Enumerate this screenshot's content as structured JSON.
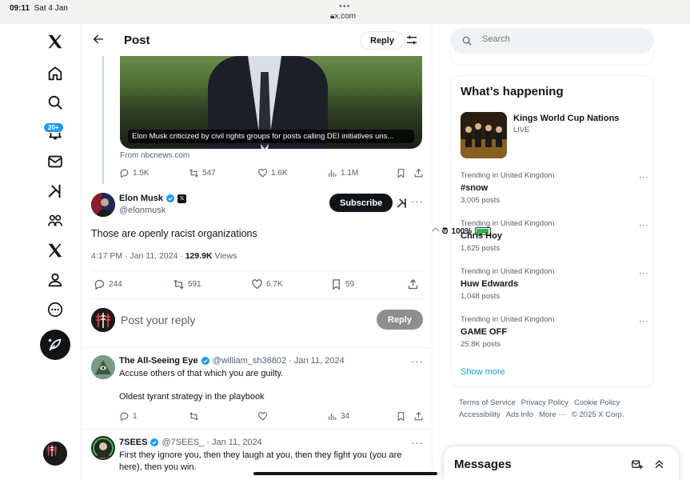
{
  "status_bar": {
    "time": "09:11",
    "date": "Sat 4 Jan",
    "url": "x.com",
    "battery": "100%"
  },
  "nav": {
    "notifications_badge": "20+",
    "icons": [
      "x-logo-icon",
      "home-icon",
      "search-icon",
      "notifications-icon",
      "messages-icon",
      "grok-icon",
      "communities-icon",
      "premium-icon",
      "profile-icon",
      "more-icon"
    ]
  },
  "header": {
    "title": "Post",
    "reply_label": "Reply"
  },
  "quoted": {
    "caption": "Elon Musk criticized by civil rights groups for posts calling DEI initiatives uns...",
    "source": "From nbcnews.com",
    "replies": "1.5K",
    "reposts": "547",
    "likes": "1.6K",
    "views": "1.1M"
  },
  "post": {
    "name": "Elon Musk",
    "handle": "@elonmusk",
    "subscribe_label": "Subscribe",
    "text": "Those are openly racist organizations",
    "time": "4:17 PM · Jan 11, 2024 · ",
    "views": "129.9K",
    "views_label": " Views",
    "replies": "244",
    "reposts": "591",
    "likes": "6.7K",
    "bookmarks": "59"
  },
  "reply_box": {
    "placeholder": "Post your reply",
    "button": "Reply"
  },
  "replies": [
    {
      "name": "The All-Seeing Eye",
      "handle": "@william_sh36802 · Jan 11, 2024",
      "line1": "Accuse others of that which you are guilty.",
      "line2": "Oldest tyrant strategy in the playbook",
      "replies": "1",
      "views": "34"
    },
    {
      "name": "7SEES",
      "handle": "@7SEES_ · Jan 11, 2024",
      "line1": "First they ignore you, then they laugh at you, then they fight you (you are",
      "line2": "here), then you win."
    }
  ],
  "search": {
    "placeholder": "Search"
  },
  "happening": {
    "title": "What’s happening",
    "event": {
      "title": "Kings World Cup Nations",
      "status": "LIVE"
    },
    "trends": [
      {
        "context": "Trending in United Kingdom",
        "name": "#snow",
        "count": "3,005 posts"
      },
      {
        "context": "Trending in United Kingdom",
        "name": "Chris Hoy",
        "count": "1,625 posts"
      },
      {
        "context": "Trending in United Kingdom",
        "name": "Huw Edwards",
        "count": "1,048 posts"
      },
      {
        "context": "Trending in United Kingdom",
        "name": "GAME OFF",
        "count": "25.8K posts"
      }
    ],
    "show_more": "Show more"
  },
  "footer": {
    "links": [
      "Terms of Service",
      "Privacy Policy",
      "Cookie Policy",
      "Accessibility",
      "Ads info",
      "More ···"
    ],
    "copyright": "© 2025 X Corp."
  },
  "messages": {
    "title": "Messages"
  },
  "colors": {
    "accent": "#1d9bf0",
    "text": "#0f1419",
    "muted": "#536471"
  }
}
